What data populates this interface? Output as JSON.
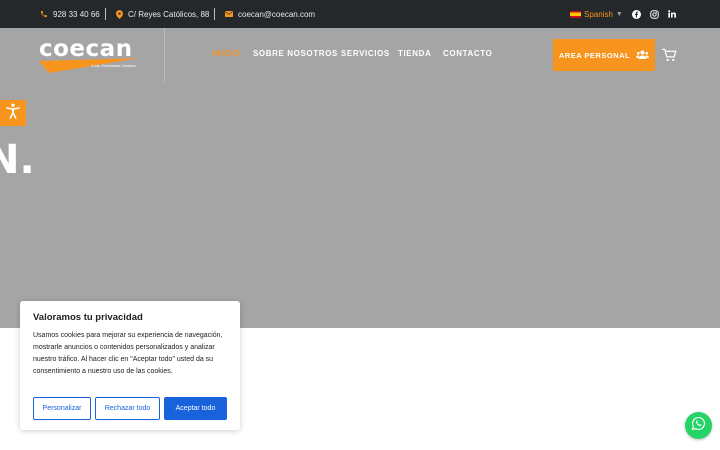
{
  "topbar": {
    "phone": "928 33 40 66",
    "address": "C/ Reyes Católicos, 88",
    "email": "coecan@coecan.com",
    "language": "Spanish",
    "icons": [
      "phone-icon",
      "map-pin-icon",
      "envelope-icon",
      "facebook-icon",
      "instagram-icon",
      "linkedin-icon"
    ]
  },
  "header": {
    "logo_text": "coecan",
    "logo_subtitle": "Coop. Estudiantes Canarios",
    "nav": [
      {
        "label": "INICIO",
        "active": true
      },
      {
        "label": "SOBRE NOSOTROS",
        "active": false
      },
      {
        "label": "SERVICIOS",
        "active": false
      },
      {
        "label": "TIENDA",
        "active": false
      },
      {
        "label": "CONTACTO",
        "active": false
      }
    ],
    "area_button": "AREA PERSONAL"
  },
  "hero": {
    "text": "N."
  },
  "cookie": {
    "title": "Valoramos tu privacidad",
    "body": "Usamos cookies para mejorar su experiencia de navegación, mostrarle anuncios o contenidos personalizados y analizar nuestro tráfico. Al hacer clic en \"Aceptar todo\" usted da su consentimiento a nuestro uso de las cookies.",
    "customize": "Personalizar",
    "reject": "Rechazar todo",
    "accept": "Aceptar todo"
  },
  "colors": {
    "accent": "#f7941d",
    "topbar_bg": "#24282b",
    "header_bg": "#a5a5a5",
    "cookie_button": "#1863dc",
    "whatsapp": "#25d366"
  }
}
